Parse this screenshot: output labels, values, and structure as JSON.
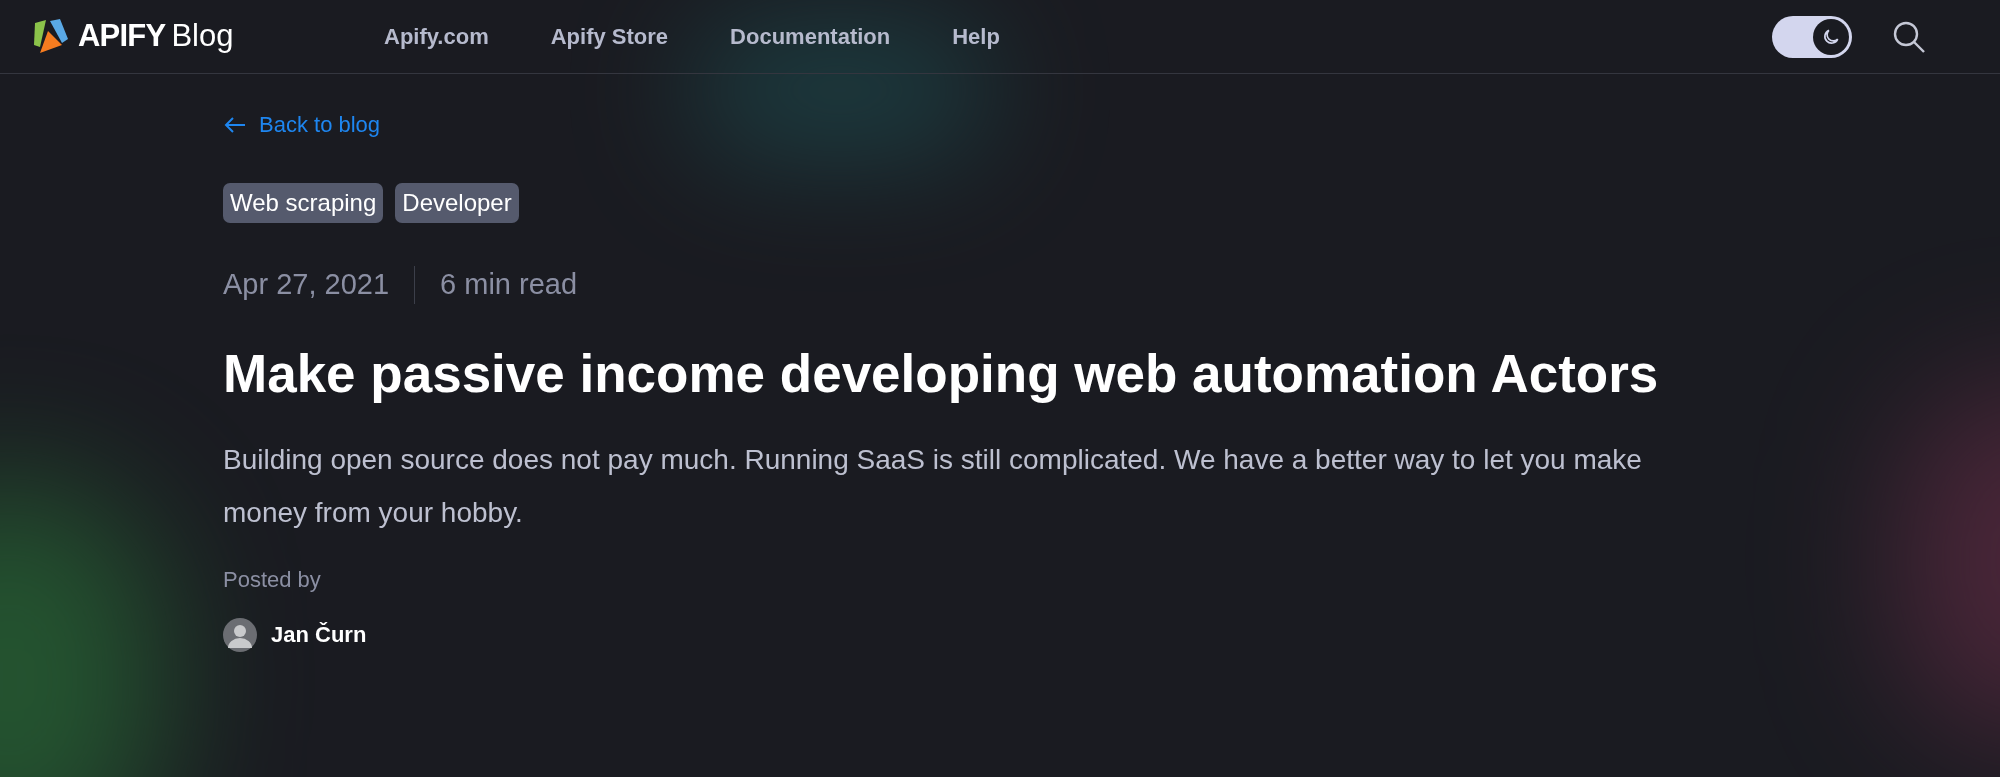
{
  "header": {
    "logo_text": "APIFY",
    "logo_suffix": "Blog",
    "nav": [
      "Apify.com",
      "Apify Store",
      "Documentation",
      "Help"
    ],
    "dark_mode": true
  },
  "article": {
    "back_link": "Back to blog",
    "tags": [
      "Web scraping",
      "Developer"
    ],
    "date": "Apr 27, 2021",
    "read_time": "6 min read",
    "title": "Make passive income developing web automation Actors",
    "summary": "Building open source does not pay much. Running SaaS is still complicated. We have a better way to let you make money from your hobby.",
    "posted_by_label": "Posted by",
    "author": "Jan Čurn"
  }
}
